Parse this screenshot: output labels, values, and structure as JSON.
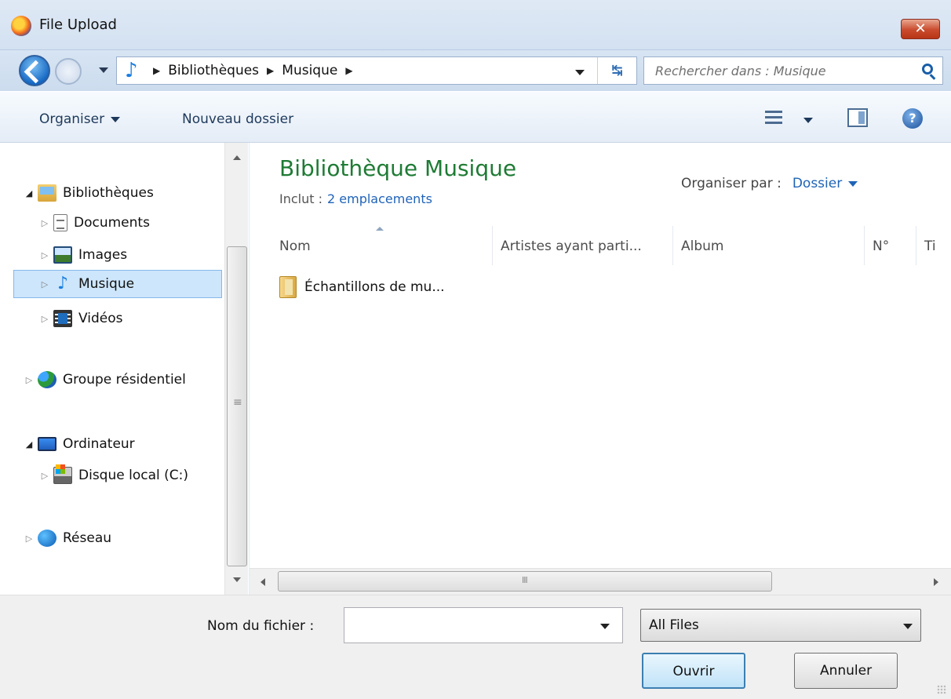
{
  "window": {
    "title": "File Upload",
    "close_label": "✕"
  },
  "address": {
    "crumbs": [
      "Bibliothèques",
      "Musique"
    ],
    "search_placeholder": "Rechercher dans : Musique"
  },
  "toolbar": {
    "organize": "Organiser",
    "new_folder": "Nouveau dossier",
    "help": "?"
  },
  "nav_tree": {
    "libraries": "Bibliothèques",
    "documents": "Documents",
    "images": "Images",
    "music": "Musique",
    "videos": "Vidéos",
    "homegroup": "Groupe résidentiel",
    "computer": "Ordinateur",
    "local_disk": "Disque local (C:)",
    "network": "Réseau",
    "selected": "Musique"
  },
  "library": {
    "title": "Bibliothèque Musique",
    "includes_label": "Inclut :",
    "includes_link": "2 emplacements",
    "arrange_label": "Organiser par :",
    "arrange_value": "Dossier"
  },
  "columns": [
    "Nom",
    "Artistes ayant parti...",
    "Album",
    "N°",
    "Ti"
  ],
  "files": [
    {
      "name": "Échantillons de mu...",
      "type": "folder"
    }
  ],
  "footer": {
    "filename_label": "Nom du fichier :",
    "filename_value": "",
    "filetype_value": "All Files",
    "open_button": "Ouvrir",
    "cancel_button": "Annuler"
  }
}
